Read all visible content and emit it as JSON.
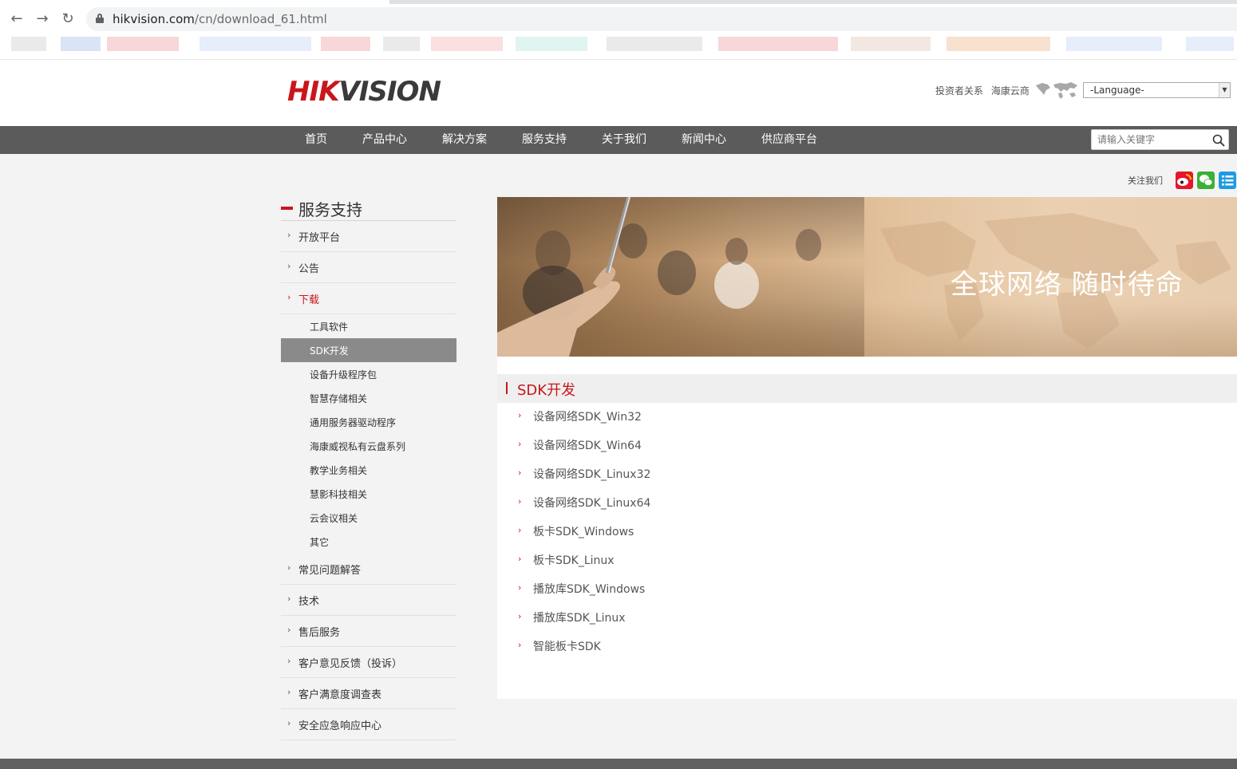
{
  "browser": {
    "url_host": "hikvision.com",
    "url_path": "/cn/download_61.html"
  },
  "header": {
    "logo_hik": "HIK",
    "logo_vision": "VISION",
    "links": [
      "投资者关系",
      "海康云商"
    ],
    "language_select": "-Language-"
  },
  "nav": {
    "items": [
      "首页",
      "产品中心",
      "解决方案",
      "服务支持",
      "关于我们",
      "新闻中心",
      "供应商平台"
    ],
    "search_placeholder": "请输入关键字"
  },
  "follow": {
    "label": "关注我们",
    "icons": [
      "weibo-icon",
      "wechat-icon",
      "list-icon"
    ],
    "colors": {
      "weibo": "#e6162d",
      "wechat": "#3cb034",
      "list": "#1e9be0"
    }
  },
  "sidebar": {
    "title": "服务支持",
    "items": [
      {
        "label": "开放平台"
      },
      {
        "label": "公告"
      },
      {
        "label": "下载",
        "active": true
      },
      {
        "label": "常见问题解答"
      },
      {
        "label": "技术"
      },
      {
        "label": "售后服务"
      },
      {
        "label": "客户意见反馈（投诉）"
      },
      {
        "label": "客户满意度调查表"
      },
      {
        "label": "安全应急响应中心"
      }
    ],
    "sub_items": [
      {
        "label": "工具软件"
      },
      {
        "label": "SDK开发",
        "selected": true
      },
      {
        "label": "设备升级程序包"
      },
      {
        "label": "智慧存储相关"
      },
      {
        "label": "通用服务器驱动程序"
      },
      {
        "label": "海康威视私有云盘系列"
      },
      {
        "label": "教学业务相关"
      },
      {
        "label": "慧影科技相关"
      },
      {
        "label": "云会议相关"
      },
      {
        "label": "其它"
      }
    ]
  },
  "banner": {
    "text": "全球网络 随时待命"
  },
  "content": {
    "section_title": "SDK开发",
    "downloads": [
      "设备网络SDK_Win32",
      "设备网络SDK_Win64",
      "设备网络SDK_Linux32",
      "设备网络SDK_Linux64",
      "板卡SDK_Windows",
      "板卡SDK_Linux",
      "播放库SDK_Windows",
      "播放库SDK_Linux",
      "智能板卡SDK"
    ]
  },
  "colors": {
    "brand_red": "#c8161d",
    "nav_bg": "#5b5b5b",
    "selected_bg": "#8a8a8a"
  }
}
